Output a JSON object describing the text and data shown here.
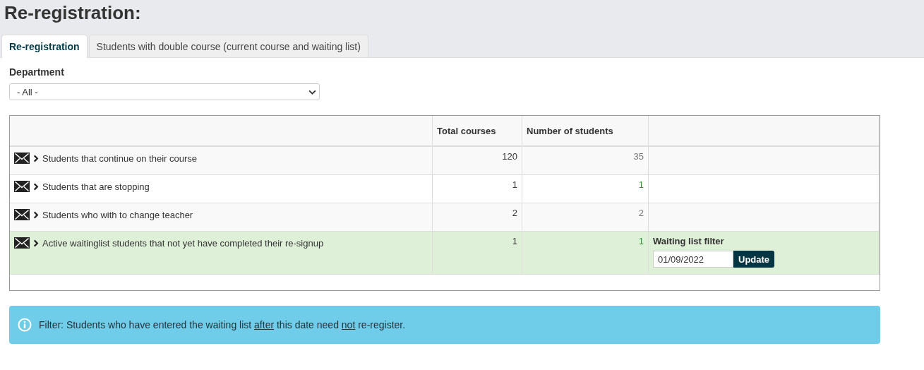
{
  "page_title": "Re-registration:",
  "tabs": [
    {
      "label": "Re-registration",
      "selected": true
    },
    {
      "label": "Students with double course (current course and waiting list)",
      "selected": false
    }
  ],
  "department": {
    "label": "Department",
    "value": "- All -"
  },
  "table": {
    "columns": [
      "Total courses",
      "Number of students"
    ],
    "rows": [
      {
        "label": "Students that continue on their course",
        "total": "120",
        "students": {
          "text": "35",
          "color": "#777777"
        },
        "highlighted": false
      },
      {
        "label": "Students that are stopping",
        "total": "1",
        "students": {
          "text": "1",
          "color": "#3c8c3c"
        },
        "highlighted": false
      },
      {
        "label": "Students who with to change teacher",
        "total": "2",
        "students": {
          "text": "2",
          "color": "#777777"
        },
        "highlighted": false
      },
      {
        "label": "Active waitinglist students that not yet have completed their re-signup",
        "total": "1",
        "students": {
          "text": "1",
          "color": "#3c8c3c"
        },
        "highlighted": true,
        "filter": {
          "label": "Waiting list filter",
          "value": "01/09/2022",
          "button": "Update"
        }
      }
    ]
  },
  "info": {
    "parts": [
      {
        "text": "Filter: Students who have entered the waiting list ",
        "underline": false
      },
      {
        "text": "after",
        "underline": true
      },
      {
        "text": " this date need ",
        "underline": false
      },
      {
        "text": "not",
        "underline": true
      },
      {
        "text": " re-register.",
        "underline": false
      }
    ]
  }
}
